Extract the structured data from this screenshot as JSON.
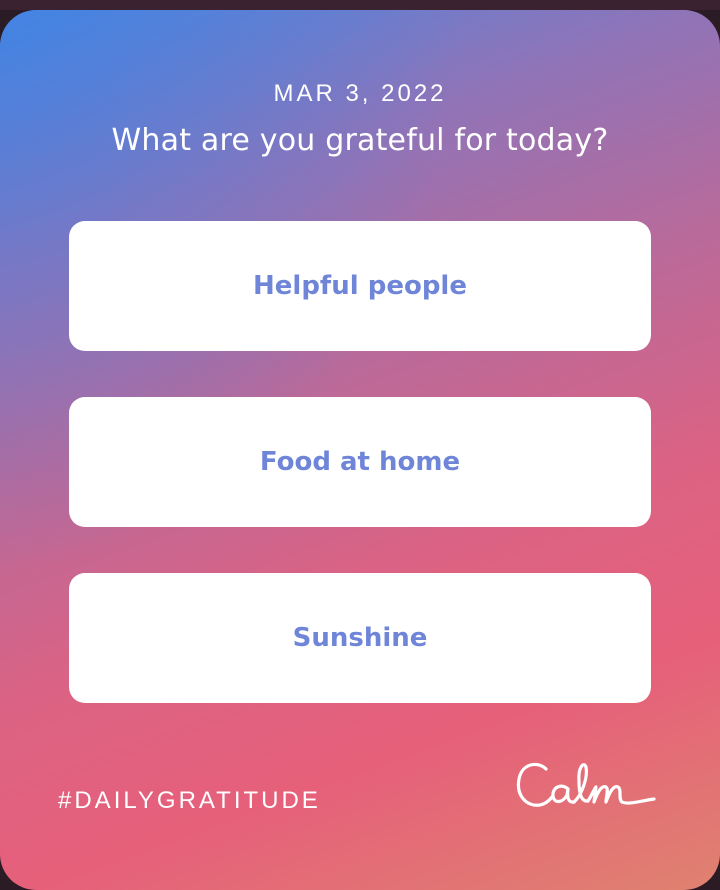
{
  "card": {
    "date": "MAR 3, 2022",
    "question": "What are you grateful for today?",
    "options": [
      {
        "label": "Helpful people"
      },
      {
        "label": "Food at home"
      },
      {
        "label": "Sunshine"
      }
    ],
    "hashtag": "#DAILYGRATITUDE",
    "logo": {
      "icon": "calm-logo-icon",
      "text": "Calm"
    }
  },
  "colors": {
    "option_text": "#6f85d8",
    "gradient_start": "#4a86e0",
    "gradient_mid": "#b96a9a",
    "gradient_end": "#df8270"
  }
}
